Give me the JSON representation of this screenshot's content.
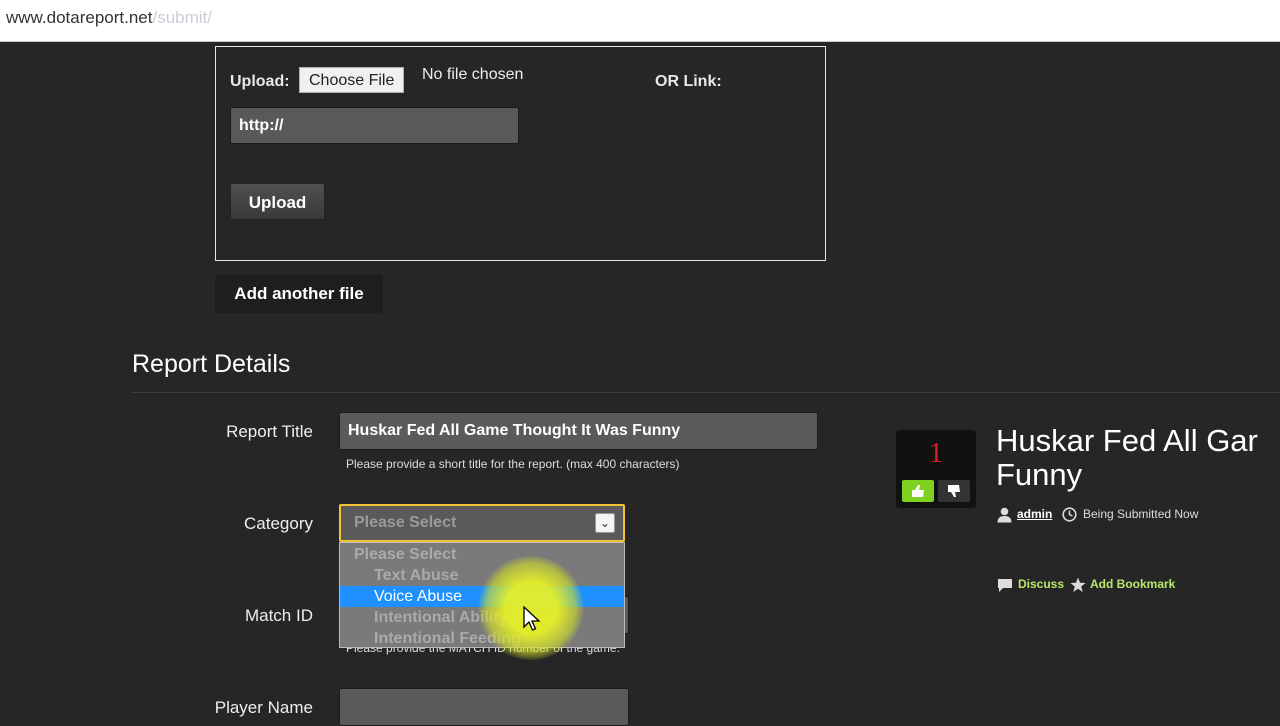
{
  "browser": {
    "url_host": "www.dotareport.net",
    "url_path": "/submit/"
  },
  "upload": {
    "upload_label": "Upload:",
    "choose_file_label": "Choose File",
    "no_file_text": "No file chosen",
    "or_link_label": "OR Link:",
    "link_value": "http://",
    "upload_button": "Upload"
  },
  "add_another_file": "Add another file",
  "report_details": {
    "heading": "Report Details",
    "title_label": "Report Title",
    "title_value": "Huskar Fed All Game Thought It Was Funny",
    "title_hint": "Please provide a short title for the report. (max 400 characters)",
    "category_label": "Category",
    "category_selected": "Please Select",
    "category_options": [
      "Please Select",
      "Text Abuse",
      "Voice Abuse",
      "Intentional Ability Abuse",
      "Intentional Feeding"
    ],
    "category_highlighted": "Voice Abuse",
    "match_label": "Match ID",
    "match_hint": "Please provide the MATCH ID number of the game.",
    "player_label": "Player Name"
  },
  "preview": {
    "vote_count": "1",
    "title_line1": "Huskar Fed All Gar",
    "title_line2": "Funny",
    "author": "admin",
    "status": "Being Submitted Now",
    "discuss": "Discuss",
    "bookmark": "Add Bookmark"
  },
  "colors": {
    "background": "#262626",
    "select_focus": "#f2c430",
    "option_highlight": "#1e90ff",
    "vote_up": "#7fd11f",
    "vote_count": "#e02020",
    "link_green": "#b8e86a"
  }
}
